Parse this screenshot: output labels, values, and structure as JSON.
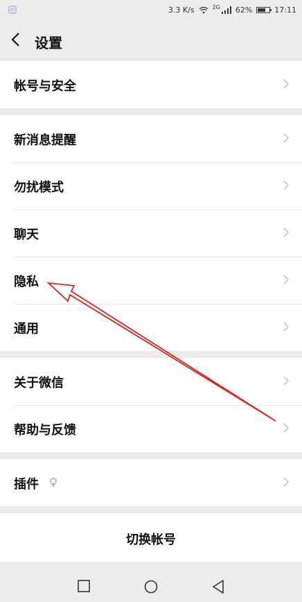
{
  "status_bar": {
    "network_speed": "3.3 K/s",
    "network_type": "2G",
    "battery": "62%",
    "time": "17:11"
  },
  "header": {
    "title": "设置"
  },
  "groups": [
    {
      "items": [
        {
          "label": "帐号与安全"
        }
      ]
    },
    {
      "items": [
        {
          "label": "新消息提醒"
        },
        {
          "label": "勿扰模式"
        },
        {
          "label": "聊天"
        },
        {
          "label": "隐私"
        },
        {
          "label": "通用"
        }
      ]
    },
    {
      "items": [
        {
          "label": "关于微信"
        },
        {
          "label": "帮助与反馈"
        }
      ]
    },
    {
      "items": [
        {
          "label": "插件"
        }
      ]
    }
  ],
  "switch_account": "切换帐号",
  "colors": {
    "background": "#ececec",
    "annotation_arrow": "#d9261c"
  },
  "annotation": {
    "type": "arrow",
    "points_to": "隐私"
  }
}
